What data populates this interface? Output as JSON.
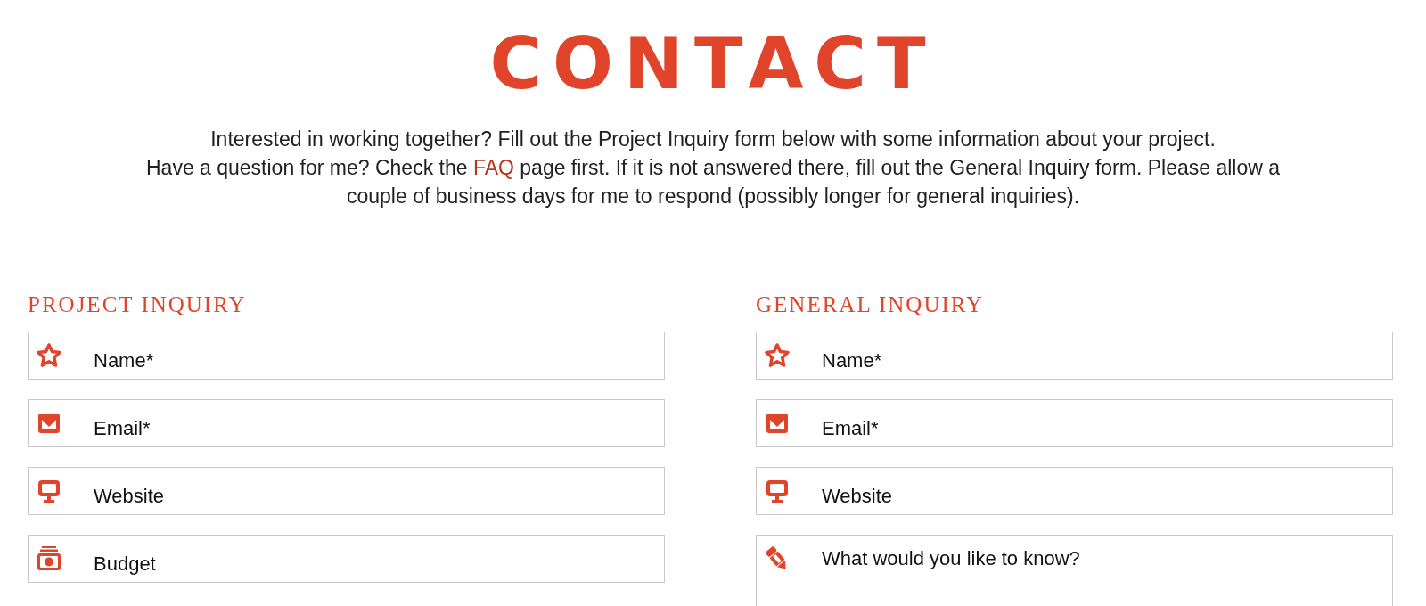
{
  "title": "CONTACT",
  "intro": [
    {
      "text": "Interested in working together? Fill out the Project Inquiry form below with some information about your project."
    },
    {
      "text": "Have a question for me? Check the ",
      "link": "FAQ",
      "text_after": " page first. If it is not answered there, fill out the General Inquiry form. Please allow a couple of business days for me to respond (possibly longer for general inquiries)."
    }
  ],
  "forms": [
    {
      "heading": "PROJECT INQUIRY",
      "fields": [
        {
          "kind": "name",
          "placeholder": "Name*"
        },
        {
          "kind": "email",
          "placeholder": "Email*"
        },
        {
          "kind": "website",
          "placeholder": "Website"
        },
        {
          "kind": "budget",
          "placeholder": "Budget"
        }
      ]
    },
    {
      "heading": "GENERAL INQUIRY",
      "fields": [
        {
          "kind": "name",
          "placeholder": "Name*"
        },
        {
          "kind": "email",
          "placeholder": "Email*"
        },
        {
          "kind": "website",
          "placeholder": "Website"
        },
        {
          "kind": "message",
          "placeholder": "What would you like to know?"
        }
      ]
    }
  ]
}
